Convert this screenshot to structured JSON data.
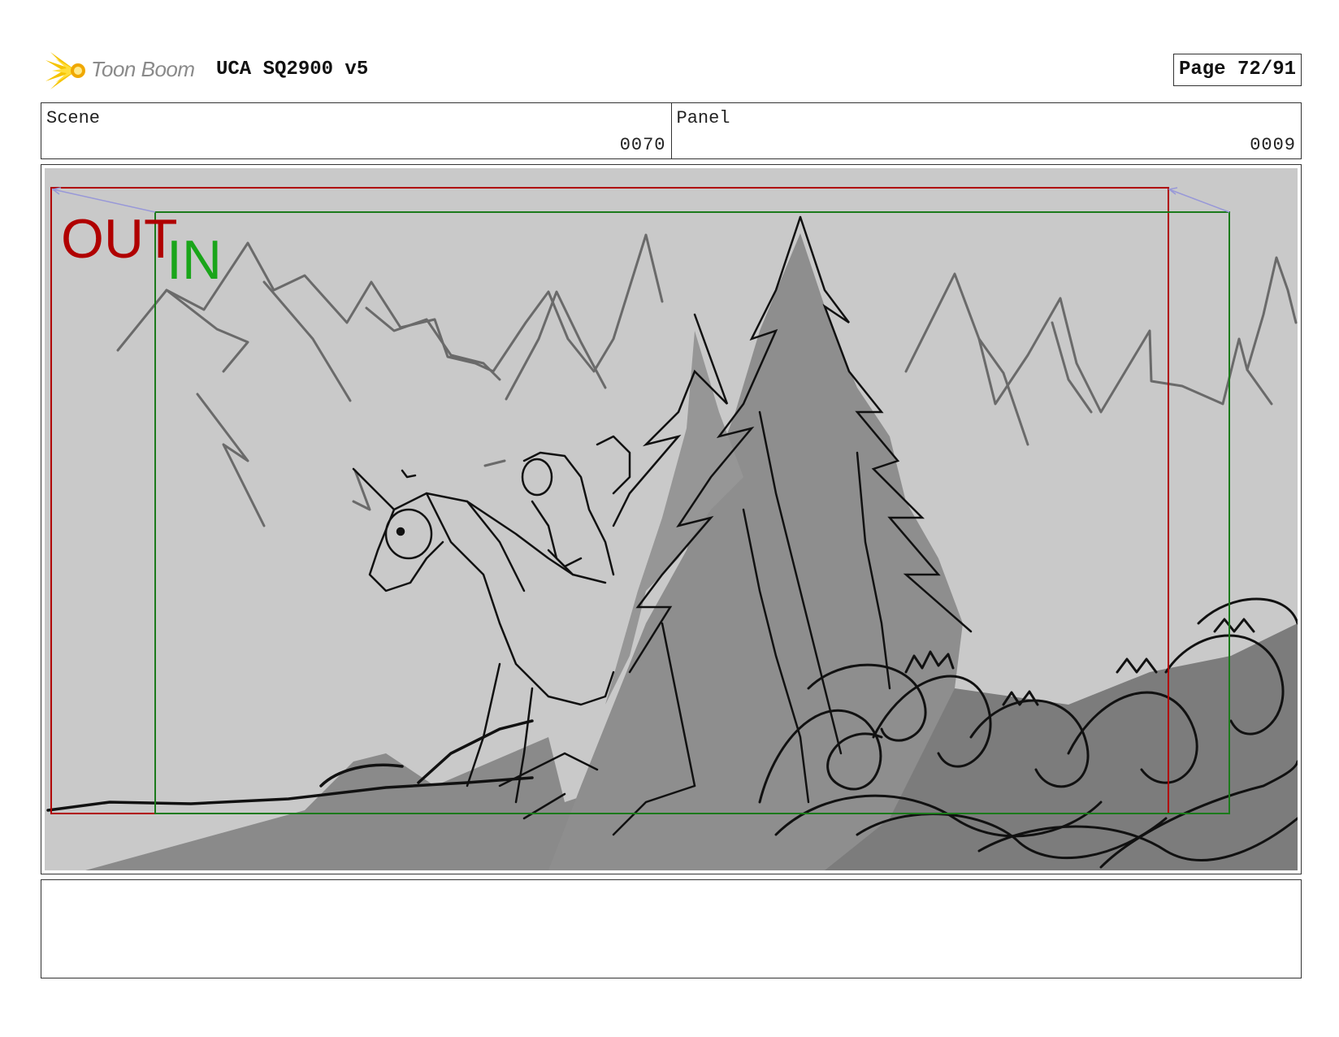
{
  "header": {
    "logo_text": "Toon Boom",
    "title": "UCA SQ2900 v5",
    "page": "Page 72/91"
  },
  "info": {
    "scene_label": "Scene",
    "scene_value": "0070",
    "panel_label": "Panel",
    "panel_value": "0009"
  },
  "frame_markers": {
    "out_label": "OUT",
    "in_label": "IN",
    "out_color": "#b00000",
    "in_color": "#1aa51a"
  },
  "notes": {
    "text": ""
  }
}
